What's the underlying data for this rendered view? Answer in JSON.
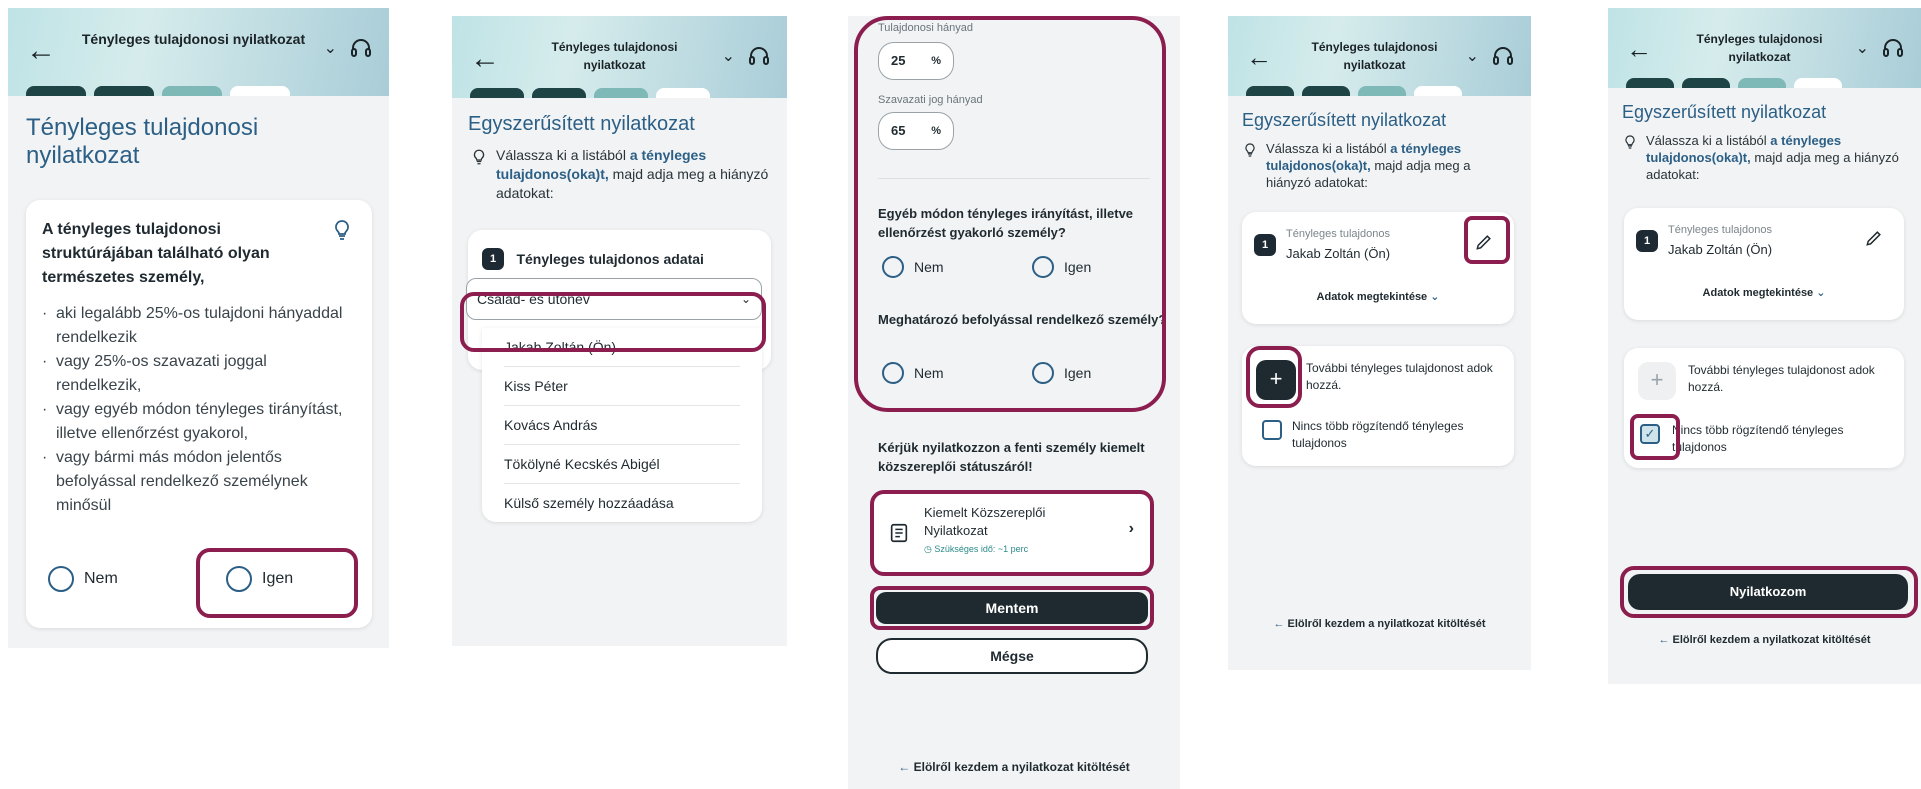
{
  "header": {
    "title": "Tényleges tulajdonosi nyilatkozat"
  },
  "icons": {
    "back": "arrow-left-icon",
    "chevron": "chevron-down-icon",
    "support": "headset-icon",
    "hint": "lightbulb-icon"
  },
  "colors": {
    "accent": "#2c5f86",
    "highlight": "#8b1e4e",
    "dark": "#1f2a30"
  },
  "screen1": {
    "page_title": "Tényleges tulajdonosi nyilatkozat",
    "card_title": "A tényleges tulajdonosi struktúrájában található olyan természetes személy,",
    "bullets": [
      "aki legalább 25%-os tulajdoni hányaddal rendelkezik",
      "vagy 25%-os szavazati joggal rendelkezik,",
      "vagy egyéb módon tényleges tirányítást, illetve ellenőrzést gyakorol,",
      "vagy bármi más módon jelentős befolyással rendelkező személynek minősül"
    ],
    "no": "Nem",
    "yes": "Igen"
  },
  "screen2": {
    "page_title": "Egyszerűsített nyilatkozat",
    "hint_pre": "Válassza ki a listából",
    "hint_bold": "a tényleges tulajdonos(oka)t,",
    "hint_post": "majd adja meg a hiányzó adatokat:",
    "section_num": "1",
    "section_title": "Tényleges tulajdonos adatai",
    "select_value": "Család- és utónév",
    "options": [
      "Jakab Zoltán (Ön)",
      "Kiss Péter",
      "Kovács András",
      "Tökölyné Kecskés Abigél",
      "Külső személy hozzáadása"
    ]
  },
  "screen3": {
    "ownership_label": "Tulajdonosi hányad",
    "ownership_value": "25",
    "voting_label": "Szavazati jog hányad",
    "voting_value": "65",
    "percent": "%",
    "q1": "Egyéb módon tényleges irányítást, illetve ellenőrzést gyakorló személy?",
    "q2": "Meghatározó befolyással rendelkező személy?",
    "no": "Nem",
    "yes": "Igen",
    "pep_prompt": "Kérjük nyilatkozzon a fenti személy kiemelt közszereplői státuszáról!",
    "pep_title": "Kiemelt Közszereplői Nyilatkozat",
    "pep_time": "Szükséges idő: ~1 perc",
    "save": "Mentem",
    "cancel": "Mégse",
    "restart": "Elölről kezdem a nyilatkozat kitöltését"
  },
  "screen4": {
    "page_title": "Egyszerűsített nyilatkozat",
    "hint_pre": "Válassza ki a listából",
    "hint_bold": "a tényleges tulajdonos(oka)t,",
    "hint_post": "majd adja meg a hiányzó adatokat:",
    "owner_num": "1",
    "owner_label": "Tényleges tulajdonos",
    "owner_name": "Jakab Zoltán (Ön)",
    "view_data": "Adatok megtekintése",
    "add_more": "További tényleges tulajdonost adok hozzá.",
    "no_more": "Nincs több rögzítendő tényleges tulajdonos",
    "restart": "Elölről kezdem a nyilatkozat kitöltését"
  },
  "screen5": {
    "page_title": "Egyszerűsített nyilatkozat",
    "hint_pre": "Válassza ki a listából",
    "hint_bold": "a tényleges tulajdonos(oka)t,",
    "hint_post": "majd adja meg a hiányzó adatokat:",
    "owner_num": "1",
    "owner_label": "Tényleges tulajdonos",
    "owner_name": "Jakab Zoltán (Ön)",
    "view_data": "Adatok megtekintése",
    "add_more": "További tényleges tulajdonost adok hozzá.",
    "no_more": "Nincs több rögzítendő tényleges tulajdonos",
    "declare": "Nyilatkozom",
    "restart": "Elölről kezdem a nyilatkozat kitöltését"
  }
}
